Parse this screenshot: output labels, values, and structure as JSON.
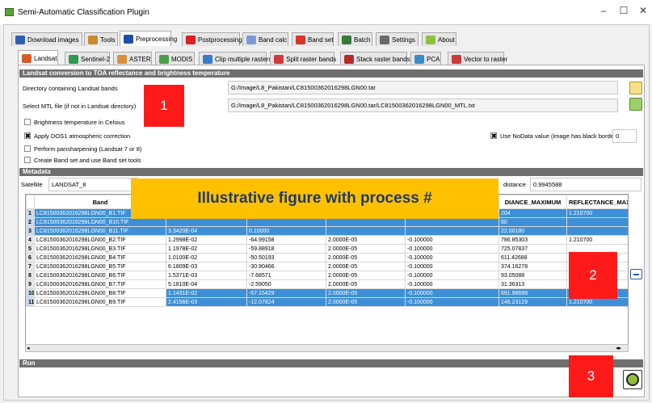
{
  "window": {
    "title": "Semi-Automatic Classification Plugin",
    "minimize": "–",
    "maximize": "☐",
    "close": "✕"
  },
  "main_tabs": [
    {
      "label": "Download images"
    },
    {
      "label": "Tools"
    },
    {
      "label": "Preprocessing"
    },
    {
      "label": "Postprocessing"
    },
    {
      "label": "Band calc"
    },
    {
      "label": "Band set"
    },
    {
      "label": "Batch"
    },
    {
      "label": "Settings"
    },
    {
      "label": "About"
    }
  ],
  "sub_tabs": [
    {
      "label": "Landsat"
    },
    {
      "label": "Sentinel-2"
    },
    {
      "label": "ASTER"
    },
    {
      "label": "MODIS"
    },
    {
      "label": "Clip multiple rasters"
    },
    {
      "label": "Split raster bands"
    },
    {
      "label": "Stack raster bands"
    },
    {
      "label": "PCA"
    },
    {
      "label": "Vector to raster"
    }
  ],
  "section_conversion": "Landsat conversion to TOA reflectance and brightness temperature",
  "dir_label": "Directory containing Landsat bands",
  "dir_value": "G:/Image/L8_Pakistan/LC81500362016298LGN00.tar",
  "mtl_label": "Select MTL file (if not in Landsat directory)",
  "mtl_value": "G:/Image/L8_Pakistan/LC81500362016298LGN00.tar/LC81500362016298LGN00_MTL.txt",
  "brightness_label": "Brightness temperature in Celsius",
  "dos1_label": "Apply DOS1 atmospheric correction",
  "nodata_label": "Use NoData value (image has black border)",
  "nodata_value": "0",
  "pansharpen_label": "Perform pansharpening (Landsat 7 or 8)",
  "bandset_label": "Create Band set and use Band set tools",
  "check_mark": "✖",
  "section_metadata": "Metadata",
  "satellite_label": "Satellite",
  "satellite_value": "LANDSAT_8",
  "distance_label": "distance",
  "distance_value": "0.9945588",
  "table": {
    "headers": [
      "",
      "Band",
      "",
      "",
      "",
      "",
      "DIANCE_MAXIMUM",
      "REFLECTANCE_MAX"
    ],
    "rows": [
      {
        "n": "1",
        "band": "LC81500362016298LGN00_B1.TIF",
        "c1": "",
        "c2": "",
        "c3": "",
        "c4": "",
        "rad": "204",
        "ref": "1.210700",
        "sel": true
      },
      {
        "n": "2",
        "band": "LC81500362016298LGN00_B10.TIF",
        "c1": "",
        "c2": "",
        "c3": "",
        "c4": "",
        "rad": "80",
        "ref": "",
        "sel": true
      },
      {
        "n": "3",
        "band": "LC81500362016298LGN00_B11.TIF",
        "c1": "3.3420E-04",
        "c2": "0.10000",
        "c3": "",
        "c4": "",
        "rad": "22.00180",
        "ref": "",
        "sel": true
      },
      {
        "n": "4",
        "band": "LC81500362016298LGN00_B2.TIF",
        "c1": "1.2998E-02",
        "c2": "-64.99158",
        "c3": "2.0000E-05",
        "c4": "-0.100000",
        "rad": "786.85303",
        "ref": "1.210700",
        "sel": false
      },
      {
        "n": "5",
        "band": "LC81500362016298LGN00_B3.TIF",
        "c1": "1.1978E-02",
        "c2": "-59.88918",
        "c3": "2.0000E-05",
        "c4": "-0.100000",
        "rad": "725.07837",
        "ref": "",
        "sel": false
      },
      {
        "n": "6",
        "band": "LC81500362016298LGN00_B4.TIF",
        "c1": "1.0100E-02",
        "c2": "-50.50193",
        "c3": "2.0000E-05",
        "c4": "-0.100000",
        "rad": "611.42688",
        "ref": "",
        "sel": false
      },
      {
        "n": "7",
        "band": "LC81500362016298LGN00_B5.TIF",
        "c1": "6.1809E-03",
        "c2": "-30.90466",
        "c3": "2.0000E-05",
        "c4": "-0.100000",
        "rad": "374.16278",
        "ref": "",
        "sel": false
      },
      {
        "n": "8",
        "band": "LC81500362016298LGN00_B6.TIF",
        "c1": "1.5371E-03",
        "c2": "-7.68571",
        "c3": "2.0000E-05",
        "c4": "-0.100000",
        "rad": "93.05088",
        "ref": "",
        "sel": false
      },
      {
        "n": "9",
        "band": "LC81500362016298LGN00_B7.TIF",
        "c1": "5.1810E-04",
        "c2": "-2.59050",
        "c3": "2.0000E-05",
        "c4": "-0.100000",
        "rad": "31.36313",
        "ref": "",
        "sel": false
      },
      {
        "n": "10",
        "band": "LC81500362016298LGN00_B8.TIF",
        "c1": "1.1431E-02",
        "c2": "-57.15429",
        "c3": "2.0000E-05",
        "c4": "-0.100000",
        "rad": "691.96698",
        "ref": "1.210700",
        "sel": true
      },
      {
        "n": "11",
        "band": "LC81500362016298LGN00_B9.TIF",
        "c1": "2.4156E-03",
        "c2": "-12.07824",
        "c3": "2.0000E-05",
        "c4": "-0.100000",
        "rad": "146.23129",
        "ref": "1.210700",
        "sel": true
      }
    ]
  },
  "scroll_left": "◂",
  "scroll_right": "◂▸",
  "section_run": "Run",
  "overlay_banner": "Illustrative figure with process #",
  "markers": [
    "1",
    "2",
    "3"
  ],
  "colors": {
    "selection": "#3d8fd8",
    "marker": "#ff1a1a",
    "banner": "#ffc000",
    "section": "#6f6f6f"
  }
}
